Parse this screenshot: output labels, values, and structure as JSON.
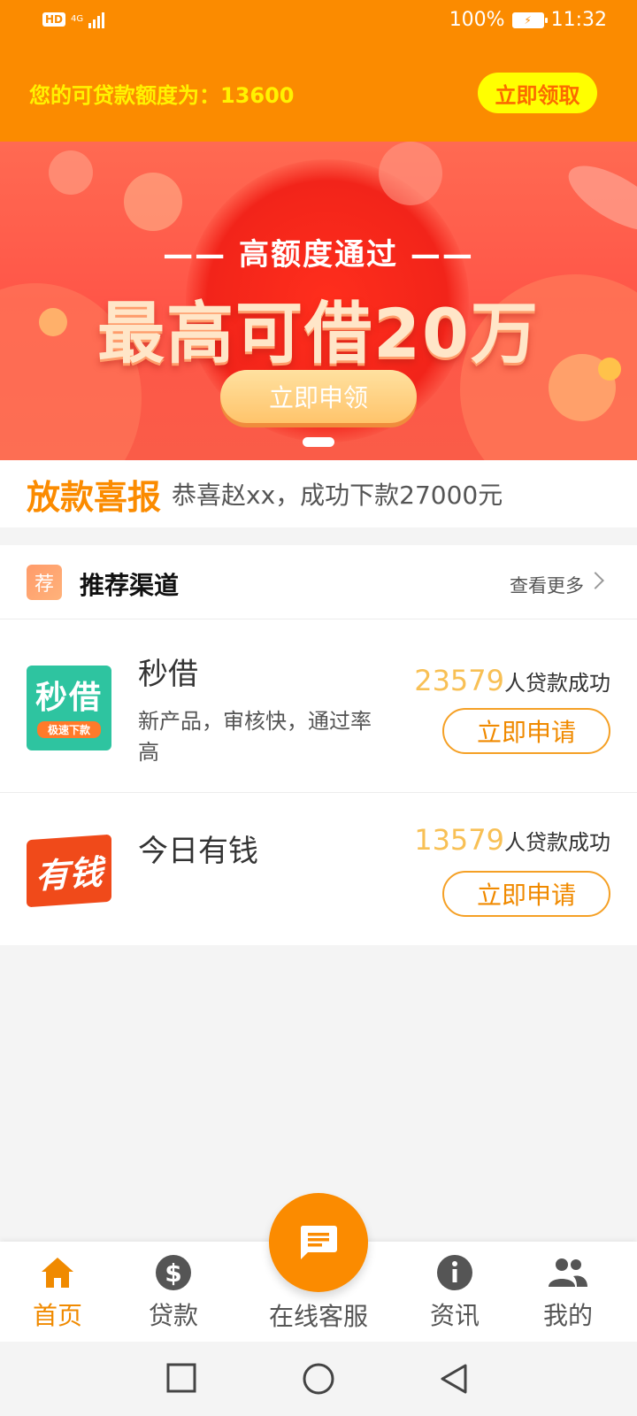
{
  "status_bar": {
    "hd": "HD",
    "network": "4G",
    "battery_percent": "100%",
    "time": "11:32"
  },
  "header": {
    "quota_text": "您的可贷款额度为：13600",
    "claim_button": "立即领取"
  },
  "banner": {
    "subtitle": "—— 高额度通过 ——",
    "headline": "最高可借20万",
    "button": "立即申领",
    "slide_index": 1
  },
  "news": {
    "title": "放款喜报",
    "text": "恭喜赵xx，成功下款27000元"
  },
  "recommend": {
    "icon_text": "荐",
    "title": "推荐渠道",
    "more": "查看更多",
    "items": [
      {
        "logo_text": "秒借",
        "logo_sub": "极速下款",
        "name": "秒借",
        "desc": "新产品，审核快，通过率高",
        "count": "23579",
        "count_suffix": "人贷款成功",
        "apply": "立即申请"
      },
      {
        "logo_text": "有钱",
        "name": "今日有钱",
        "desc": "",
        "count": "13579",
        "count_suffix": "人贷款成功",
        "apply": "立即申请"
      }
    ]
  },
  "bottom_nav": {
    "items": [
      {
        "label": "首页",
        "icon": "home-icon",
        "active": true
      },
      {
        "label": "贷款",
        "icon": "dollar-icon",
        "active": false
      },
      {
        "label": "在线客服",
        "icon": "chat-icon",
        "active": false
      },
      {
        "label": "资讯",
        "icon": "info-icon",
        "active": false
      },
      {
        "label": "我的",
        "icon": "people-icon",
        "active": false
      }
    ]
  },
  "colors": {
    "brand_orange": "#fb8b00",
    "quota_yellow": "#fff200",
    "banner_red": "#ff5648",
    "count_gold": "#f8c055"
  }
}
